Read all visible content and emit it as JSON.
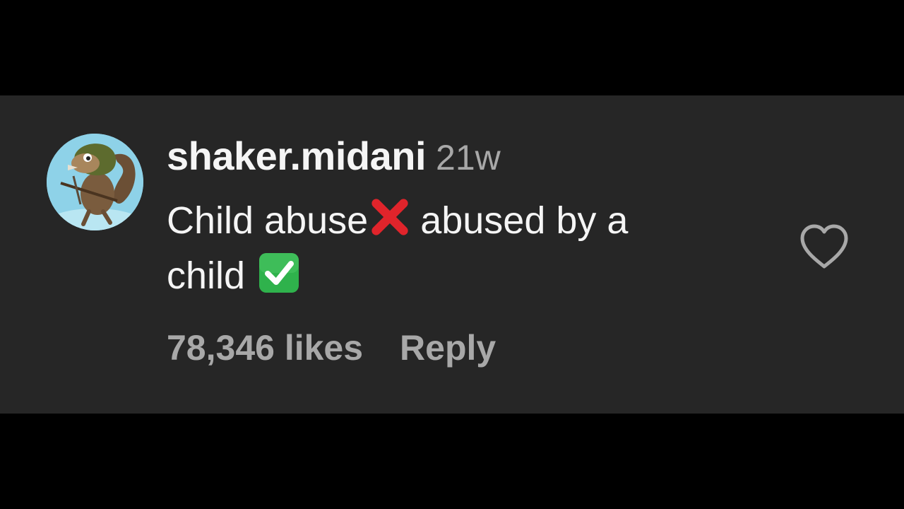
{
  "comment": {
    "username": "shaker.midani",
    "timestamp": "21w",
    "text_line_1": "Child abuse",
    "text_line_1_after_emoji": "abused by a",
    "text_line_2": "child",
    "emoji_1": "cross-mark-emoji",
    "emoji_2": "check-mark-button-emoji",
    "likes_count": "78,346 likes",
    "reply_label": "Reply",
    "like_icon": "heart-outline-icon",
    "avatar": "squirrel-avatar"
  },
  "colors": {
    "page_background": "#000000",
    "card_background": "#262626",
    "primary_text": "#f5f5f5",
    "secondary_text": "#a8a8a8",
    "cross_red": "#e0242b",
    "check_green": "#2fb24c"
  }
}
